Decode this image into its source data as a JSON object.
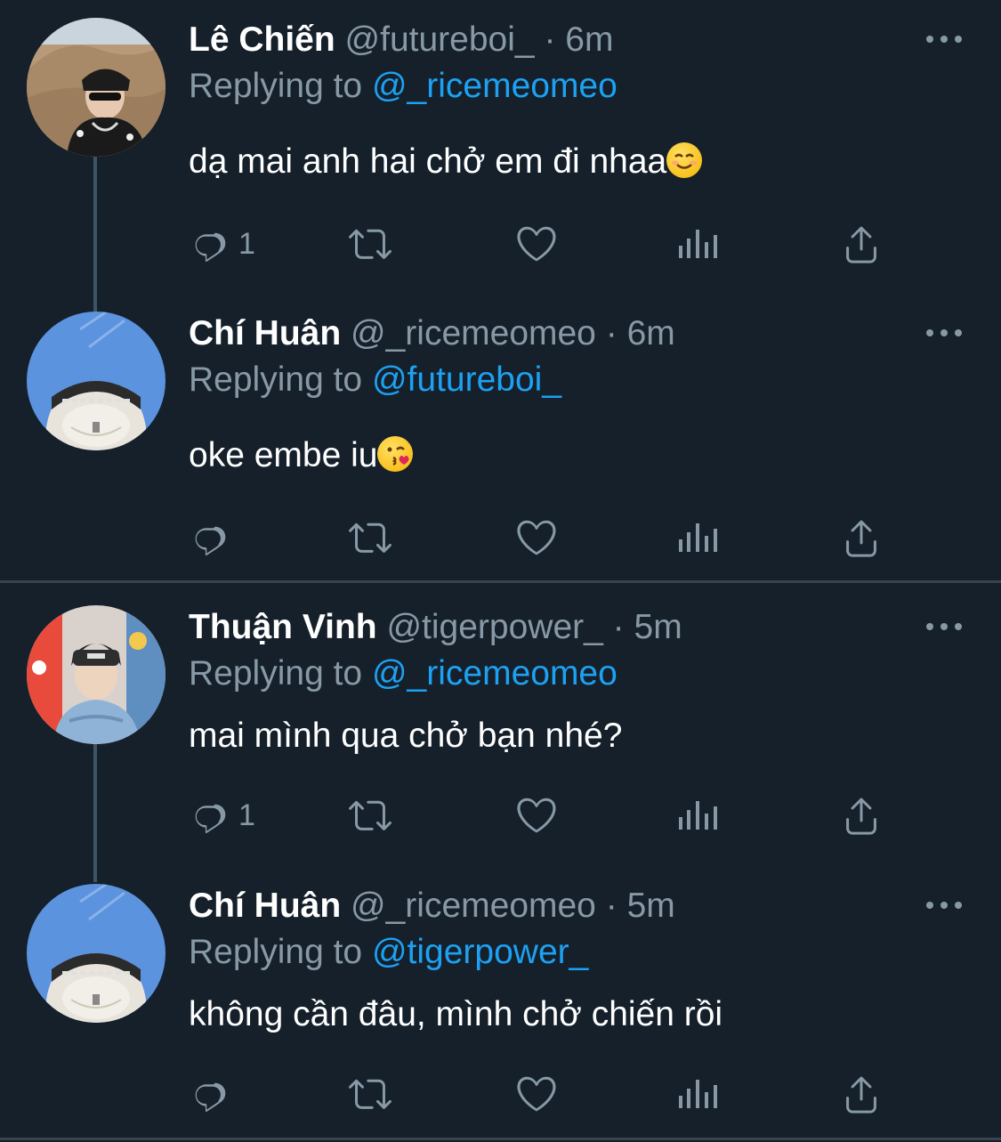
{
  "tweets": [
    {
      "name": "Lê Chiến",
      "handle": "@futureboi_",
      "sep": "·",
      "time": "6m",
      "replying_prefix": "Replying to ",
      "replying_to": "@_ricemeomeo",
      "text": "dạ mai anh hai chở em đi nhaa",
      "emoji": "☺️",
      "reply_count": "1"
    },
    {
      "name": "Chí Huân",
      "handle": "@_ricemeomeo",
      "sep": "·",
      "time": "6m",
      "replying_prefix": "Replying to ",
      "replying_to": "@futureboi_",
      "text": "oke embe iu",
      "emoji": "😘",
      "reply_count": ""
    },
    {
      "name": "Thuận Vinh",
      "handle": "@tigerpower_",
      "sep": "·",
      "time": "5m",
      "replying_prefix": "Replying to ",
      "replying_to": "@_ricemeomeo",
      "text": "mai mình qua chở bạn nhé?",
      "reply_count": "1"
    },
    {
      "name": "Chí Huân",
      "handle": "@_ricemeomeo",
      "sep": "·",
      "time": "5m",
      "replying_prefix": "Replying to ",
      "replying_to": "@tigerpower_",
      "text": "không cần đâu, mình chở chiến rồi",
      "reply_count": ""
    }
  ],
  "icons": [
    "reply-icon",
    "retweet-icon",
    "like-icon",
    "analytics-icon",
    "share-icon",
    "more-icon"
  ],
  "colors": {
    "background": "#15202b",
    "text_secondary": "#8899a6",
    "link": "#1da1f2",
    "divider": "#38444d"
  }
}
